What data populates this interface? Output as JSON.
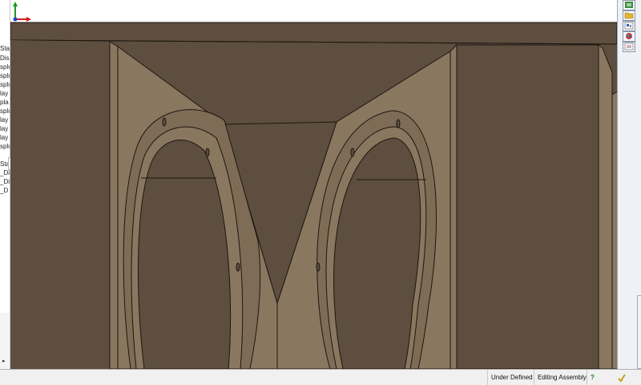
{
  "feature_tree": {
    "items": [
      "Sta",
      "Disp",
      "splu",
      "splu",
      "splu",
      "lay",
      "pla",
      "splu",
      "lay",
      "lay",
      "lay",
      "splu",
      "Sta",
      "_Di",
      "_Di",
      "_D"
    ],
    "collapse_toggle": "‹"
  },
  "task_pane": {
    "buttons": [
      "resources-icon",
      "folder-icon",
      "view-palette-icon",
      "appearance-icon",
      "custom-properties-icon"
    ]
  },
  "status_bar": {
    "definition_state": "Under Defined",
    "editing_mode": "Editing Assembly",
    "help_label": "?"
  },
  "colors": {
    "model_background": "#5d4e3f",
    "model_face_light": "#8a7760",
    "model_face_mid": "#7e6c57",
    "model_edge": "#1e1710"
  }
}
